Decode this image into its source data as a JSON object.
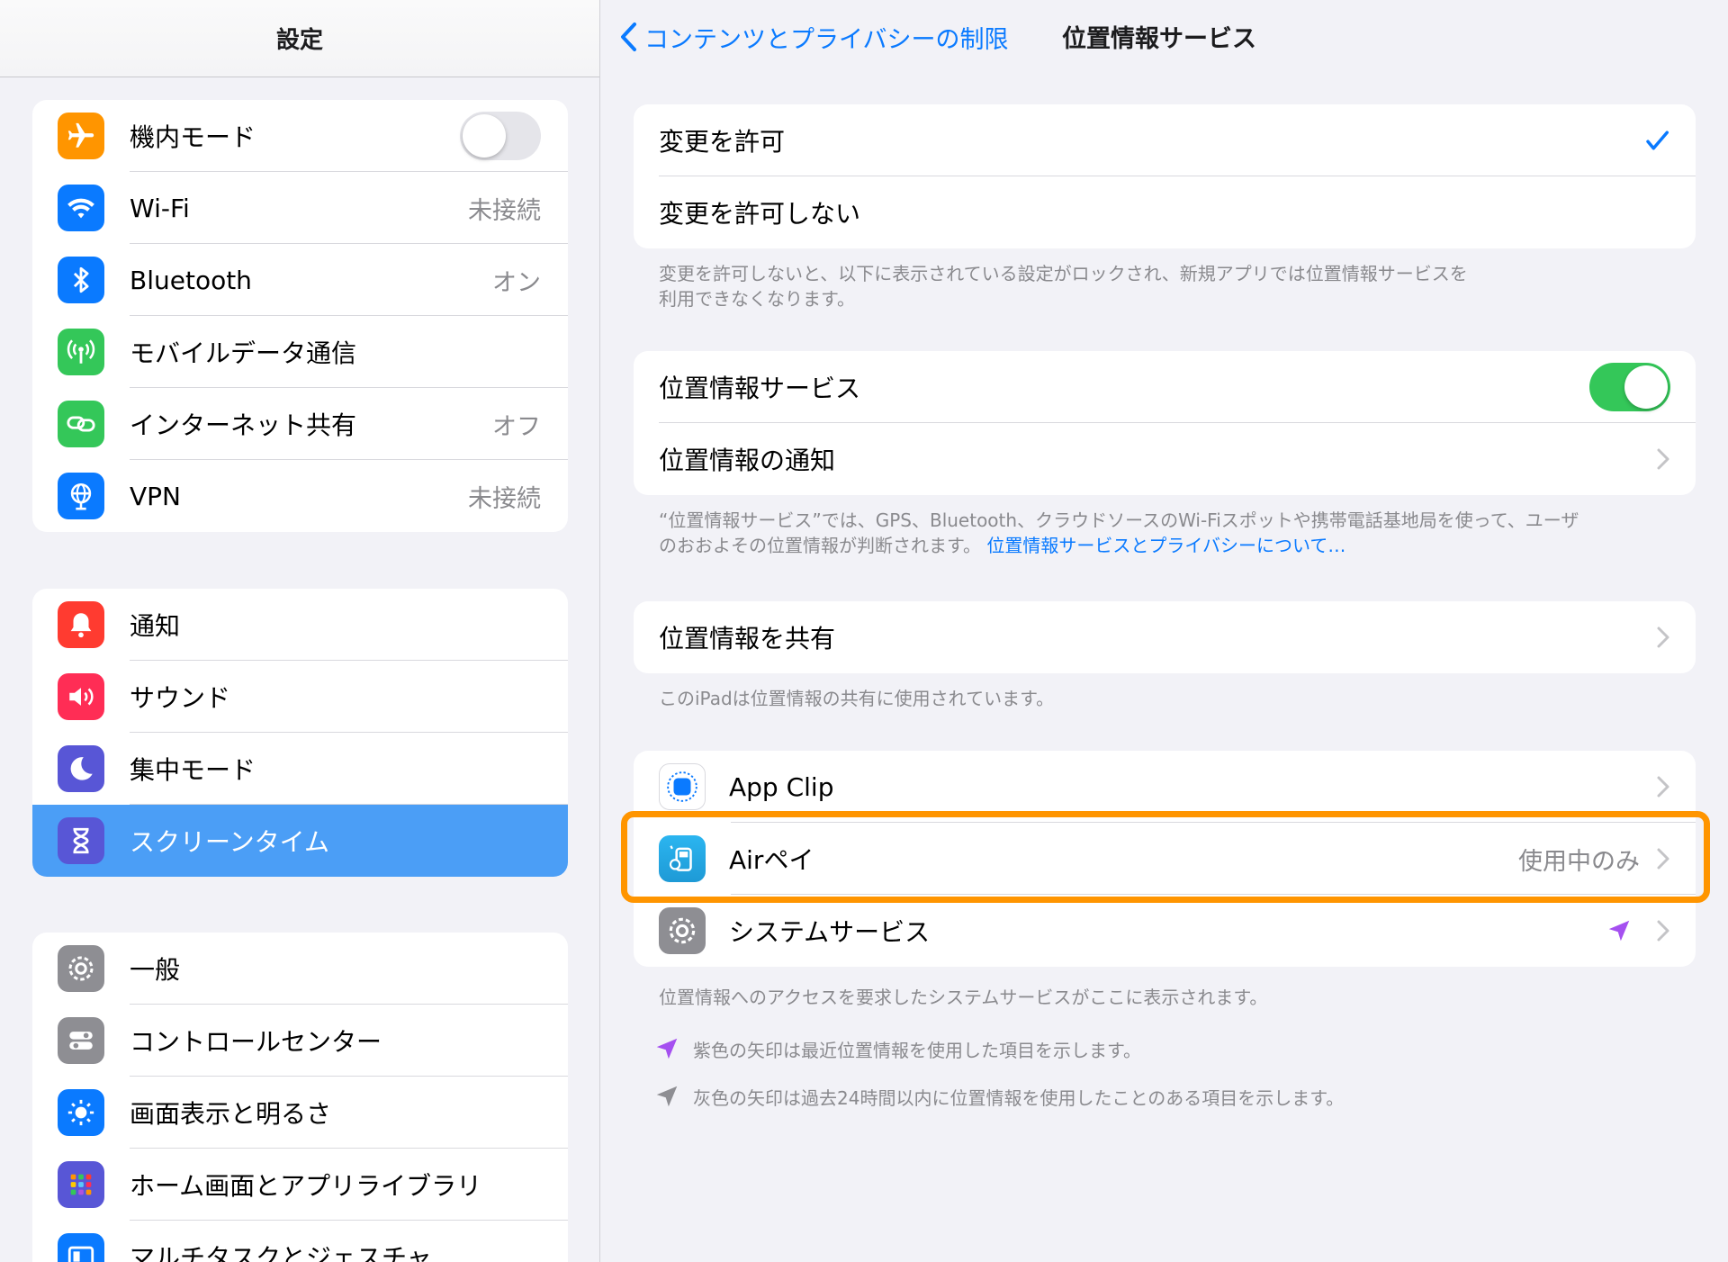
{
  "sidebar": {
    "title": "設定",
    "groups": [
      [
        {
          "label": "機内モード",
          "icon": "airplane-icon",
          "color": "#ff9500",
          "toggle": "off"
        },
        {
          "label": "Wi-Fi",
          "icon": "wifi-icon",
          "color": "#0a7aff",
          "value": "未接続"
        },
        {
          "label": "Bluetooth",
          "icon": "bluetooth-icon",
          "color": "#0a7aff",
          "value": "オン"
        },
        {
          "label": "モバイルデータ通信",
          "icon": "cellular-icon",
          "color": "#34c759"
        },
        {
          "label": "インターネット共有",
          "icon": "hotspot-icon",
          "color": "#34c759",
          "value": "オフ"
        },
        {
          "label": "VPN",
          "icon": "vpn-globe-icon",
          "color": "#0a7aff",
          "value": "未接続"
        }
      ],
      [
        {
          "label": "通知",
          "icon": "bell-icon",
          "color": "#ff3b30"
        },
        {
          "label": "サウンド",
          "icon": "speaker-icon",
          "color": "#ff2d55"
        },
        {
          "label": "集中モード",
          "icon": "moon-icon",
          "color": "#5856d6"
        },
        {
          "label": "スクリーンタイム",
          "icon": "hourglass-icon",
          "color": "#5856d6",
          "selected": true
        }
      ],
      [
        {
          "label": "一般",
          "icon": "gear-icon",
          "color": "#8e8e93"
        },
        {
          "label": "コントロールセンター",
          "icon": "switches-icon",
          "color": "#8e8e93"
        },
        {
          "label": "画面表示と明るさ",
          "icon": "sun-icon",
          "color": "#0a7aff"
        },
        {
          "label": "ホーム画面とアプリライブラリ",
          "icon": "app-grid-icon",
          "color": "#5856d6"
        },
        {
          "label": "マルチタスクとジェスチャ",
          "icon": "multitask-icon",
          "color": "#0a7aff"
        }
      ]
    ]
  },
  "nav": {
    "back_label": "コンテンツとプライバシーの制限",
    "title": "位置情報サービス"
  },
  "permission": {
    "allow_label": "変更を許可",
    "deny_label": "変更を許可しない",
    "footnote_line1": "変更を許可しないと、以下に表示されている設定がロックされ、新規アプリでは位置情報サービスを",
    "footnote_line2": "利用できなくなります。"
  },
  "location": {
    "services_label": "位置情報サービス",
    "services_toggle": "on",
    "alerts_label": "位置情報の通知",
    "footnote_line1": "“位置情報サービス”では、GPS、Bluetooth、クラウドソースのWi-Fiスポットや携帯電話基地局を使って、ユーザ",
    "footnote_line2": "のおおよその位置情報が判断されます。",
    "footnote_link": "位置情報サービスとプライバシーについて…"
  },
  "share": {
    "label": "位置情報を共有",
    "footnote": "このiPadは位置情報の共有に使用されています。"
  },
  "apps": {
    "items": [
      {
        "label": "App Clip",
        "icon": "app-clip-icon",
        "value": ""
      },
      {
        "label": "Airペイ",
        "icon": "airpay-icon",
        "value": "使用中のみ"
      },
      {
        "label": "システムサービス",
        "icon": "gear-icon",
        "value": ""
      }
    ],
    "footnote": "位置情報へのアクセスを要求したシステムサービスがここに表示されます。",
    "legend_purple": "紫色の矢印は最近位置情報を使用した項目を示します。",
    "legend_gray": "灰色の矢印は過去24時間以内に位置情報を使用したことのある項目を示します。"
  },
  "colors": {
    "accent": "#0a7aff",
    "selected_row": "#4b9ef6",
    "toggle_on": "#34c759",
    "highlight": "#ff9500",
    "arrow_purple": "#a550f0",
    "arrow_gray": "#8e8e93"
  }
}
